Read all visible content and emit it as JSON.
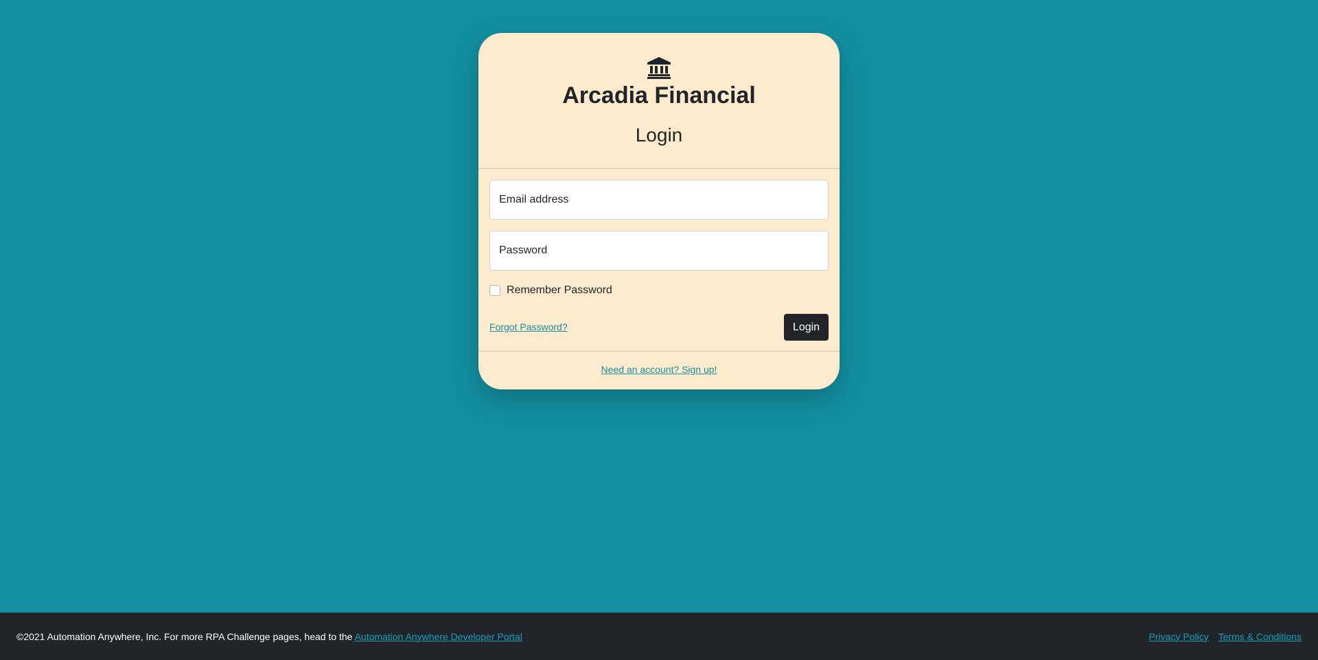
{
  "card": {
    "brand": "Arcadia Financial",
    "heading": "Login",
    "email_placeholder": "Email address",
    "password_placeholder": "Password",
    "remember_label": "Remember Password",
    "forgot_link": "Forgot Password?",
    "login_button": "Login",
    "signup_link": "Need an account? Sign up!",
    "bank_icon": "bank-icon"
  },
  "footer": {
    "copyright": "©2021 Automation Anywhere, Inc. For more RPA Challenge pages, head to the ",
    "portal_link": "Automation Anywhere Developer Portal",
    "privacy_link": "Privacy Policy",
    "terms_link": "Terms & Conditions"
  },
  "colors": {
    "background": "#138fa0",
    "card": "#feebcd",
    "button": "#212529",
    "link": "#138fa0",
    "footer": "#212529"
  }
}
